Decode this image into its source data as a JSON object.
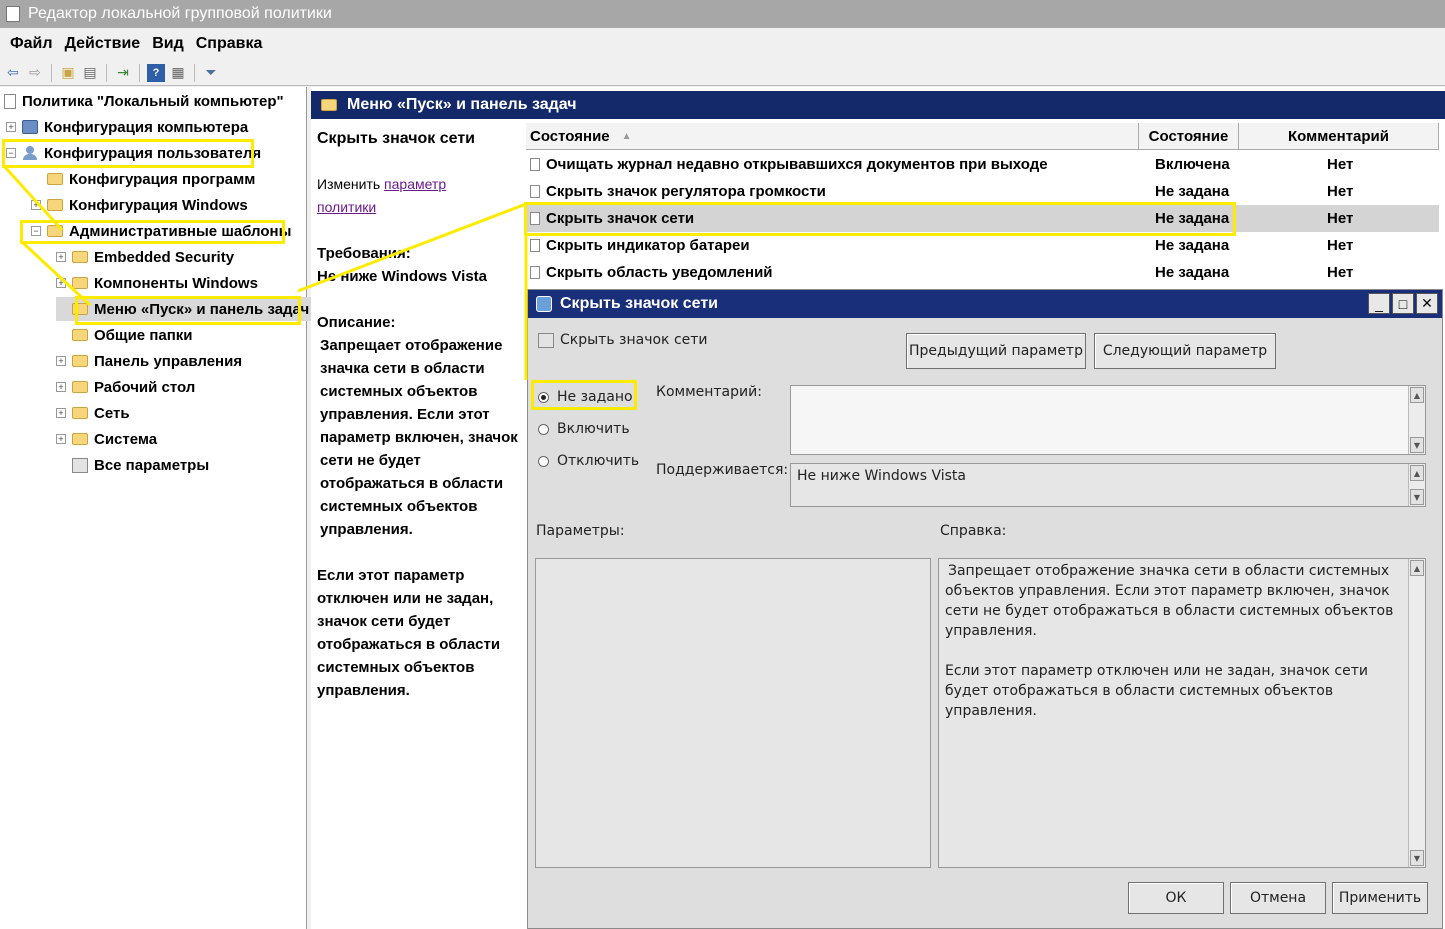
{
  "window": {
    "title": "Редактор локальной групповой политики"
  },
  "menu": [
    "Файл",
    "Действие",
    "Вид",
    "Справка"
  ],
  "toolbar": [
    "back-icon",
    "forward-icon",
    "up-folder-icon",
    "show-hide-tree-icon",
    "export-icon",
    "help-icon",
    "properties-icon",
    "filter-icon"
  ],
  "tree": {
    "root": "Политика \"Локальный компьютер\"",
    "items": [
      {
        "label": "Конфигурация компьютера",
        "expander": "+",
        "icon": "computer-icon"
      },
      {
        "label": "Конфигурация пользователя",
        "expander": "−",
        "icon": "user-icon"
      },
      {
        "label": "Конфигурация программ",
        "expander": "",
        "icon": "folder-icon"
      },
      {
        "label": "Конфигурация Windows",
        "expander": "+",
        "icon": "folder-icon"
      },
      {
        "label": "Административные шаблоны",
        "expander": "−",
        "icon": "folder-icon"
      },
      {
        "label": "Embedded Security",
        "expander": "+",
        "icon": "folder-icon"
      },
      {
        "label": "Компоненты Windows",
        "expander": "+",
        "icon": "folder-icon"
      },
      {
        "label": "Меню «Пуск» и панель задач",
        "expander": "",
        "icon": "folder-icon"
      },
      {
        "label": "Общие папки",
        "expander": "",
        "icon": "folder-icon"
      },
      {
        "label": "Панель управления",
        "expander": "+",
        "icon": "folder-icon"
      },
      {
        "label": "Рабочий стол",
        "expander": "+",
        "icon": "folder-icon"
      },
      {
        "label": "Сеть",
        "expander": "+",
        "icon": "folder-icon"
      },
      {
        "label": "Система",
        "expander": "+",
        "icon": "folder-icon"
      },
      {
        "label": "Все параметры",
        "expander": "",
        "icon": "settings-icon"
      }
    ]
  },
  "content": {
    "header": "Меню «Пуск» и панель задач",
    "desc": {
      "title": "Скрыть значок сети",
      "edit_prefix": "Изменить ",
      "edit_link1": "параметр ",
      "edit_link2": "политики",
      "req_label": "Требования:",
      "req_value": "Не ниже Windows Vista",
      "desc_label": "Описание:",
      "desc_p1": "Запрещает отображение значка сети в области системных объектов управления. Если этот параметр включен, значок сети не будет отображаться в области системных объектов управления.",
      "desc_p2": "Если этот параметр отключен или не задан, значок сети будет отображаться в области системных объектов управления."
    },
    "columns": [
      "Состояние",
      "Состояние",
      "Комментарий"
    ],
    "rows": [
      {
        "name": "Очищать журнал недавно открывавшихся документов при выходе",
        "state": "Включена",
        "comment": "Нет"
      },
      {
        "name": "Скрыть значок регулятора громкости",
        "state": "Не задана",
        "comment": "Нет"
      },
      {
        "name": "Скрыть значок сети",
        "state": "Не задана",
        "comment": "Нет"
      },
      {
        "name": "Скрыть индикатор батареи",
        "state": "Не задана",
        "comment": "Нет"
      },
      {
        "name": "Скрыть область уведомлений",
        "state": "Не задана",
        "comment": "Нет"
      }
    ]
  },
  "dialog": {
    "title": "Скрыть значок сети",
    "setting_name": "Скрыть значок сети",
    "prev_button": "Предыдущий параметр",
    "next_button": "Следующий параметр",
    "options": [
      "Не задано",
      "Включить",
      "Отключить"
    ],
    "selected_option": "Не задано",
    "comment_label": "Комментарий:",
    "supported_label": "Поддерживается:",
    "supported_value": "Не ниже Windows Vista",
    "params_label": "Параметры:",
    "help_label": "Справка:",
    "help_p1": "Запрещает отображение значка сети в области системных объектов управления. Если этот параметр включен, значок сети не будет отображаться в области системных объектов управления.",
    "help_p2": "Если этот параметр отключен или не задан, значок сети будет отображаться в области системных объектов управления.",
    "ok_button": "ОК",
    "cancel_button": "Отмена",
    "apply_button": "Применить"
  },
  "colors": {
    "highlight": "#ffeb00",
    "header_bg": "#14296a",
    "dialog_title_bg": "#1a2f7a",
    "link": "#6b1a8c"
  }
}
